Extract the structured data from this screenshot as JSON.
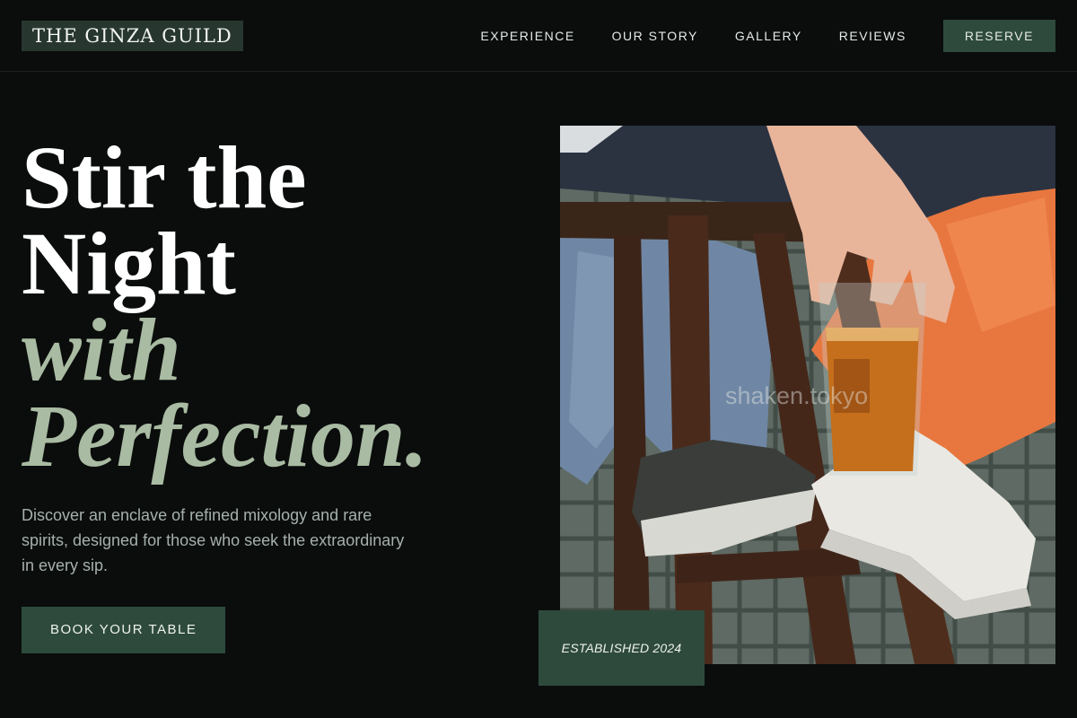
{
  "brand": {
    "logo_text": "THE GINZA GUILD"
  },
  "nav": {
    "items": [
      {
        "label": "EXPERIENCE"
      },
      {
        "label": "OUR STORY"
      },
      {
        "label": "GALLERY"
      },
      {
        "label": "REVIEWS"
      }
    ],
    "cta_label": "RESERVE"
  },
  "hero": {
    "headline_line1": "Stir the",
    "headline_line2": "Night",
    "headline_accent1": "with",
    "headline_accent2": "Perfection.",
    "description": "Discover an enclave of refined mixology and rare spirits, designed for those who seek the extraordinary in every sip.",
    "cta_label": "BOOK YOUR TABLE"
  },
  "photo": {
    "watermark": "shaken.tokyo",
    "badge": "ESTABLISHED 2024"
  },
  "colors": {
    "background": "#0a0d0c",
    "accent_green": "#2e4a3c",
    "sage_text": "#a9bba2",
    "muted_text": "#a6b0ad"
  }
}
